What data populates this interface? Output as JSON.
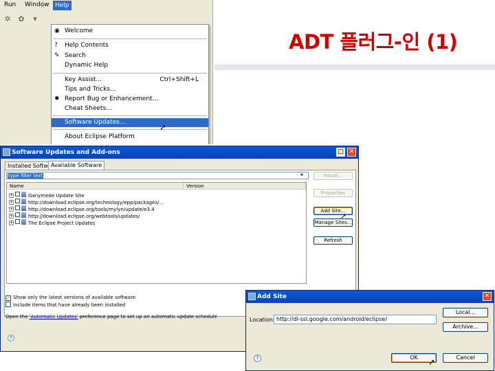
{
  "slide": {
    "title": "ADT 플러그-인 (1)"
  },
  "eclipse_menu": {
    "menubar": [
      "Run",
      "Window",
      "Help"
    ],
    "toolbar_icons": [
      "debug-icon",
      "run-icon",
      "external-tools-icon"
    ],
    "items": [
      {
        "label": "Welcome",
        "icon": "welcome-icon",
        "shortcut": ""
      },
      {
        "label": "Help Contents",
        "icon": "help-contents-icon",
        "shortcut": ""
      },
      {
        "label": "Search",
        "icon": "search-help-icon",
        "shortcut": ""
      },
      {
        "label": "Dynamic Help",
        "icon": "",
        "shortcut": ""
      },
      {
        "label": "Key Assist...",
        "icon": "",
        "shortcut": "Ctrl+Shift+L"
      },
      {
        "label": "Tips and Tricks...",
        "icon": "",
        "shortcut": ""
      },
      {
        "label": "Report Bug or Enhancement...",
        "icon": "bug-icon",
        "shortcut": ""
      },
      {
        "label": "Cheat Sheets...",
        "icon": "",
        "shortcut": ""
      },
      {
        "label": "Software Updates...",
        "icon": "",
        "shortcut": "",
        "selected": true
      },
      {
        "label": "About Eclipse Platform",
        "icon": "",
        "shortcut": ""
      }
    ]
  },
  "software_updates": {
    "title": "Software Updates and Add-ons",
    "tabs": [
      "Installed Software",
      "Available Software"
    ],
    "active_tab": "Available Software",
    "filter_text": "type filter text",
    "columns": [
      "Name",
      "Version"
    ],
    "sites": [
      "Ganymede Update Site",
      "http://download.eclipse.org/technology/epp/packages/...",
      "http://download.eclipse.org/tools/mylyn/update/e3.4",
      "http://download.eclipse.org/webtools/updates/",
      "The Eclipse Project Updates"
    ],
    "buttons": {
      "install": "Install...",
      "properties": "Properties",
      "add_site": "Add Site...",
      "manage_sites": "Manage Sites...",
      "refresh": "Refresh"
    },
    "show_latest_label": "Show only the latest versions of available software",
    "show_latest_checked": true,
    "include_installed_label": "Include items that have already been installed",
    "include_installed_checked": false,
    "footnote_prefix": "Open the ",
    "footnote_link": "'Automatic Updates'",
    "footnote_suffix": " preference page to set up an automatic update schedule"
  },
  "add_site": {
    "title": "Add Site",
    "location_label": "Location:",
    "location_value": "http://dl-ssl.google.com/android/eclipse/",
    "buttons": {
      "local": "Local...",
      "archive": "Archive...",
      "ok": "OK",
      "cancel": "Cancel"
    }
  },
  "colors": {
    "title_red": "#d40000",
    "selection_blue": "#316ac5",
    "xp_titlebar": "#0842b5",
    "dialog_bg": "#ece9d8"
  }
}
